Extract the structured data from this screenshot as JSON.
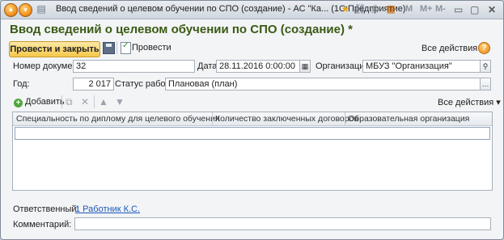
{
  "window": {
    "title": "Ввод сведений о целевом обучении по СПО (создание) - АС \"Ка...  (1С:Предприятие)",
    "toolbar_m": [
      "M",
      "M+",
      "M-"
    ]
  },
  "header": {
    "title": "Ввод сведений о целевом обучении по СПО (создание) *",
    "post_close_label": "Провести и закрыть",
    "post_label": "Провести",
    "all_actions": "Все действия"
  },
  "fields": {
    "doc_number_label": "Номер документа:",
    "doc_number": "32",
    "date_label": "Дата:",
    "date": "28.11.2016  0:00:00",
    "org_label": "Организация:",
    "org": "МБУЗ \"Организация\"",
    "year_label": "Год:",
    "year": "2 017",
    "status_label": "Статус работы:",
    "status": "Плановая (план)"
  },
  "table": {
    "add_label": "Добавить",
    "all_actions": "Все действия",
    "columns": [
      "Специальность по диплому для целевого обучения",
      "Количество заключенных договоров",
      "Образовательная организация"
    ]
  },
  "footer": {
    "responsible_label": "Ответственный:",
    "responsible": "1 Работник К.С.",
    "comment_label": "Комментарий:",
    "comment": ""
  }
}
